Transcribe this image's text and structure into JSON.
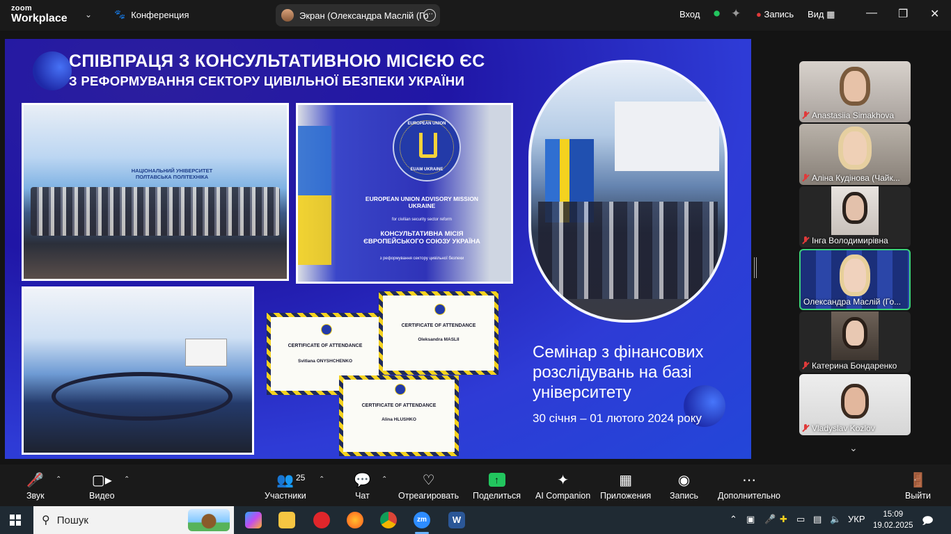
{
  "titlebar": {
    "brand_line1": "zoom",
    "brand_line2": "Workplace",
    "conference_label": "Конференция",
    "screen_label": "Экран (Олександра Маслій (Го",
    "login_label": "Вход",
    "record_label": "Запись",
    "view_label": "Вид"
  },
  "slide": {
    "title_line1": "СПІВПРАЦЯ З КОНСУЛЬТАТИВНОЮ МІСІЄЮ ЄС",
    "title_line2": "З РЕФОРМУВАННЯ СЕКТОРУ ЦИВІЛЬНОЇ БЕЗПЕКИ УКРАЇНИ",
    "room_sign": "НАЦІОНАЛЬНИЙ УНІВЕРСИТЕТ\nПОЛТАВСЬКА ПОЛІТЕХНІКА",
    "banner": {
      "ring_top": "EUROPEAN UNION",
      "ring_bottom": "EUAM UKRAINE",
      "en_title": "EUROPEAN UNION ADVISORY MISSION UKRAINE",
      "en_sub": "for civilian security sector reform",
      "ua_title": "КОНСУЛЬТАТИВНА МІСІЯ ЄВРОПЕЙСЬКОГО СОЮЗУ УКРАЇНА",
      "ua_sub": "з реформування сектору цивільної безпеки"
    },
    "certificates": [
      {
        "heading": "CERTIFICATE OF ATTENDANCE",
        "name": "Svitlana ONYSHCHENKO"
      },
      {
        "heading": "CERTIFICATE OF ATTENDANCE",
        "name": "Oleksandra MASLII"
      },
      {
        "heading": "CERTIFICATE OF ATTENDANCE",
        "name": "Alina HLUSHKO"
      }
    ],
    "seminar_text": "Семінар з фінансових\nрозслідувань на базі\nуніверситету",
    "seminar_date": "30 січня – 01 лютого 2024 року"
  },
  "participants": [
    {
      "name": "Anastasiia Simakhova",
      "muted": true
    },
    {
      "name": "Аліна Кудінова (Чайк...",
      "muted": true
    },
    {
      "name": "Інга Володимирівна",
      "muted": true
    },
    {
      "name": "Олександра Маслій (Го...",
      "muted": false,
      "active": true
    },
    {
      "name": "Катерина Бондаренко",
      "muted": true
    },
    {
      "name": "Vladyslav Kozlov",
      "muted": true
    }
  ],
  "toolbar": {
    "audio": "Звук",
    "video": "Видео",
    "participants": "Участники",
    "participants_count": "25",
    "chat": "Чат",
    "react": "Отреагировать",
    "share": "Поделиться",
    "ai": "AI Companion",
    "apps": "Приложения",
    "record": "Запись",
    "more": "Дополнительно",
    "leave": "Выйти"
  },
  "taskbar": {
    "search_label": "Пошук",
    "lang": "УКР",
    "time": "15:09",
    "date": "19.02.2025"
  },
  "colors": {
    "accent_green": "#22c55e",
    "record_red": "#e03a3a",
    "slide_blue": "#2346d8"
  }
}
